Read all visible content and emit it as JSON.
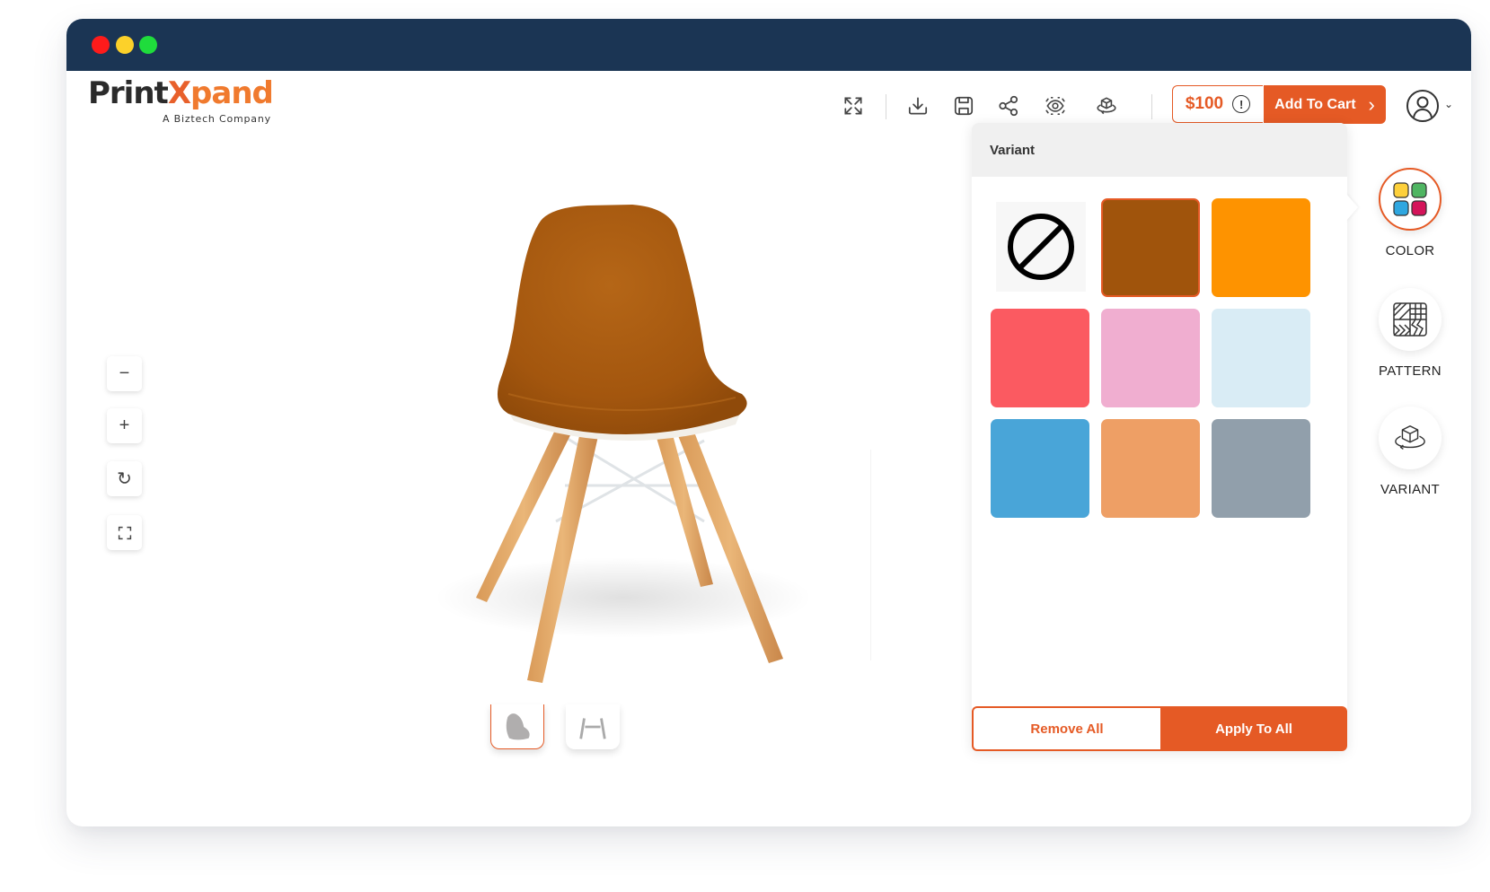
{
  "window": {
    "traffic_lights": [
      {
        "name": "close",
        "color": "#fe1b1b"
      },
      {
        "name": "minimize",
        "color": "#fcd12a"
      },
      {
        "name": "maximize",
        "color": "#1fdc3c"
      }
    ]
  },
  "brand": {
    "logo_part1": "Print",
    "logo_part2": "X",
    "logo_part3": "pand",
    "tagline": "A Biztech Company",
    "accent": "#e55a25"
  },
  "toolbar": {
    "icons": [
      "expand-icon",
      "download-icon",
      "save-icon",
      "share-icon",
      "preview-icon",
      "3d-view-icon"
    ],
    "price": "$100",
    "price_info": "!",
    "add_to_cart": "Add To Cart",
    "add_to_cart_chevron": "›"
  },
  "zoom_controls": {
    "zoom_out": "−",
    "zoom_in": "+",
    "reset": "↻",
    "fit": "fit"
  },
  "canvas": {
    "product": "chair",
    "shell_color": "#a3560e",
    "thumbnails": [
      {
        "name": "seat",
        "active": true
      },
      {
        "name": "legs",
        "active": false
      }
    ]
  },
  "variant_panel": {
    "title": "Variant",
    "swatches": [
      {
        "name": "none",
        "color": null
      },
      {
        "name": "brown",
        "color": "#a0540c",
        "selected": true
      },
      {
        "name": "orange",
        "color": "#fe9300"
      },
      {
        "name": "coral-red",
        "color": "#fb5a61"
      },
      {
        "name": "pink",
        "color": "#f0aed0"
      },
      {
        "name": "light-blue",
        "color": "#d9ecf5"
      },
      {
        "name": "blue",
        "color": "#49a5d8"
      },
      {
        "name": "peach",
        "color": "#ee9f65"
      },
      {
        "name": "slate-gray",
        "color": "#919fab"
      }
    ],
    "remove_all": "Remove All",
    "apply_to_all": "Apply To All"
  },
  "side_tools": [
    {
      "label": "COLOR",
      "active": true
    },
    {
      "label": "PATTERN",
      "active": false
    },
    {
      "label": "VARIANT",
      "active": false
    }
  ]
}
